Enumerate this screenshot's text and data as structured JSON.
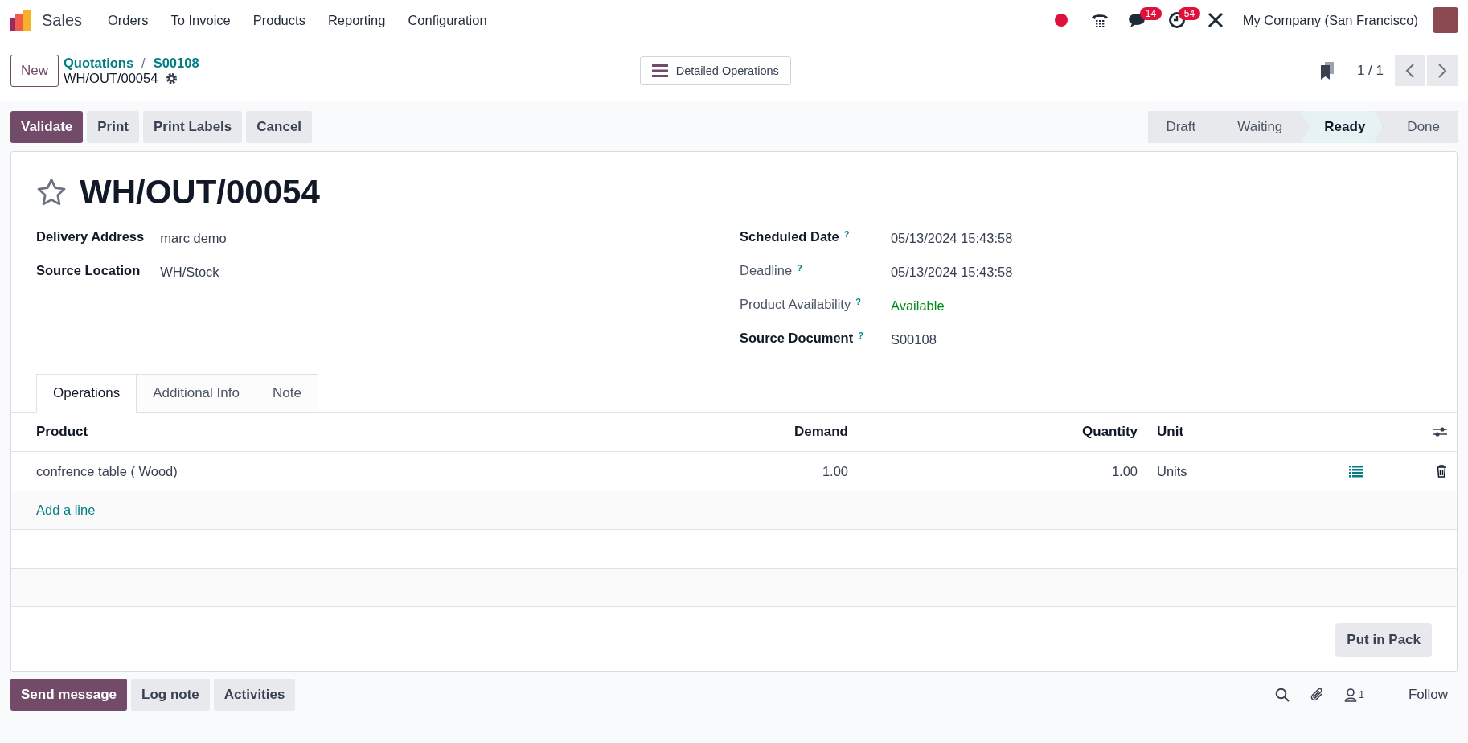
{
  "navbar": {
    "app": "Sales",
    "menu": [
      "Orders",
      "To Invoice",
      "Products",
      "Reporting",
      "Configuration"
    ],
    "chat_badge": "14",
    "activity_badge": "54",
    "company": "My Company (San Francisco)"
  },
  "control_panel": {
    "new_button": "New",
    "breadcrumbs": [
      "Quotations",
      "S00108"
    ],
    "breadcrumb_separator": "/",
    "record": "WH/OUT/00054",
    "detailed_button": "Detailed Operations",
    "pager": "1 / 1"
  },
  "actions": [
    {
      "label": "Validate",
      "primary": true
    },
    {
      "label": "Print",
      "primary": false
    },
    {
      "label": "Print Labels",
      "primary": false
    },
    {
      "label": "Cancel",
      "primary": false
    }
  ],
  "stages": [
    {
      "label": "Draft",
      "selected": false
    },
    {
      "label": "Waiting",
      "selected": false
    },
    {
      "label": "Ready",
      "selected": true
    },
    {
      "label": "Done",
      "selected": false
    }
  ],
  "form": {
    "title": "WH/OUT/00054",
    "starred": false,
    "left_fields": [
      {
        "label": "Delivery Address",
        "value": "marc demo",
        "required": true,
        "kind": "text"
      },
      {
        "label": "Source Location",
        "value": "WH/Stock",
        "required": true,
        "kind": "text"
      }
    ],
    "right_fields": [
      {
        "label": "Scheduled Date",
        "help": "?",
        "value": "05/13/2024 15:43:58",
        "required": true,
        "kind": "text"
      },
      {
        "label": "Deadline",
        "help": "?",
        "value": "05/13/2024 15:43:58",
        "required": false,
        "kind": "text"
      },
      {
        "label": "Product Availability",
        "help": "?",
        "value": "Available",
        "required": false,
        "kind": "status"
      },
      {
        "label": "Source Document",
        "help": "?",
        "value": "S00108",
        "required": true,
        "kind": "text"
      }
    ],
    "tabs": [
      {
        "label": "Operations",
        "selected": true
      },
      {
        "label": "Additional Info",
        "selected": false
      },
      {
        "label": "Note",
        "selected": false
      }
    ],
    "table": {
      "columns": [
        "Product",
        "Demand",
        "Quantity",
        "Unit"
      ],
      "rows": [
        {
          "product": "confrence table ( Wood)",
          "demand": "1.00",
          "quantity": "1.00",
          "unit": "Units"
        }
      ],
      "add_line": "Add a line"
    },
    "put_in_pack": "Put in Pack"
  },
  "chatter": {
    "buttons": [
      {
        "label": "Send message",
        "primary": true
      },
      {
        "label": "Log note",
        "primary": false
      },
      {
        "label": "Activities",
        "primary": false
      }
    ],
    "followers": "1",
    "follow": "Follow"
  }
}
